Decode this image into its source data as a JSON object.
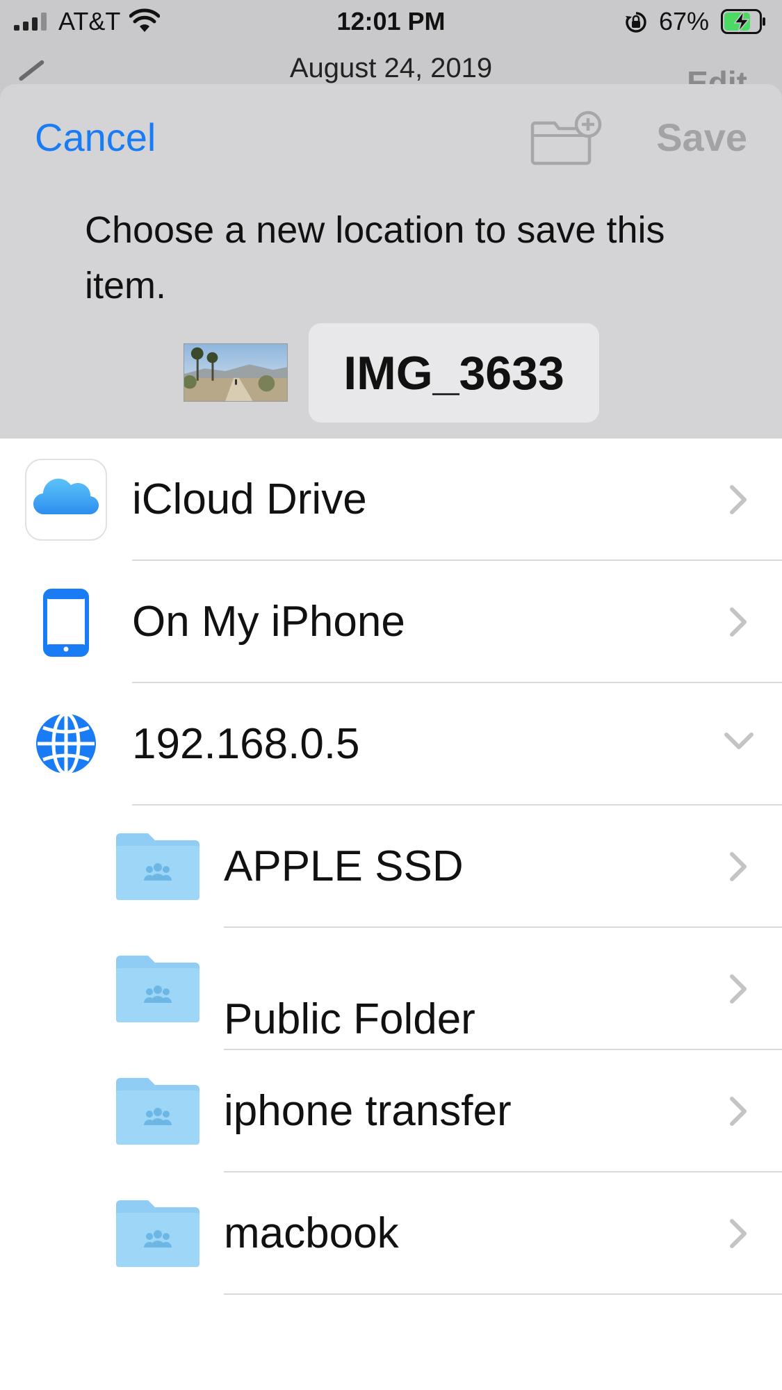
{
  "status_bar": {
    "carrier": "AT&T",
    "time": "12:01 PM",
    "battery_percent": "67%",
    "battery_level": 0.67,
    "charging": true
  },
  "background_nav": {
    "date": "August 24, 2019",
    "edit_label": "Edit"
  },
  "sheet": {
    "cancel_label": "Cancel",
    "save_label": "Save",
    "prompt": "Choose a new location to save this item.",
    "filename": "IMG_3633"
  },
  "locations": [
    {
      "label": "iCloud Drive",
      "icon": "icloud-drive-icon",
      "accessory": "chevron-right"
    },
    {
      "label": "On My iPhone",
      "icon": "iphone-icon",
      "accessory": "chevron-right"
    },
    {
      "label": "192.168.0.5",
      "icon": "globe-icon",
      "accessory": "chevron-down"
    }
  ],
  "server_folders": [
    {
      "label": "APPLE SSD",
      "icon": "shared-folder-icon"
    },
    {
      "label": "Public Folder",
      "icon": "shared-folder-icon"
    },
    {
      "label": "iphone transfer",
      "icon": "shared-folder-icon"
    },
    {
      "label": "macbook",
      "icon": "shared-folder-icon"
    }
  ],
  "colors": {
    "accent": "#1a7cf5",
    "disabled_text": "#a3a3a6",
    "folder_blue": "#8fcdf5",
    "battery_green": "#4cd964"
  }
}
